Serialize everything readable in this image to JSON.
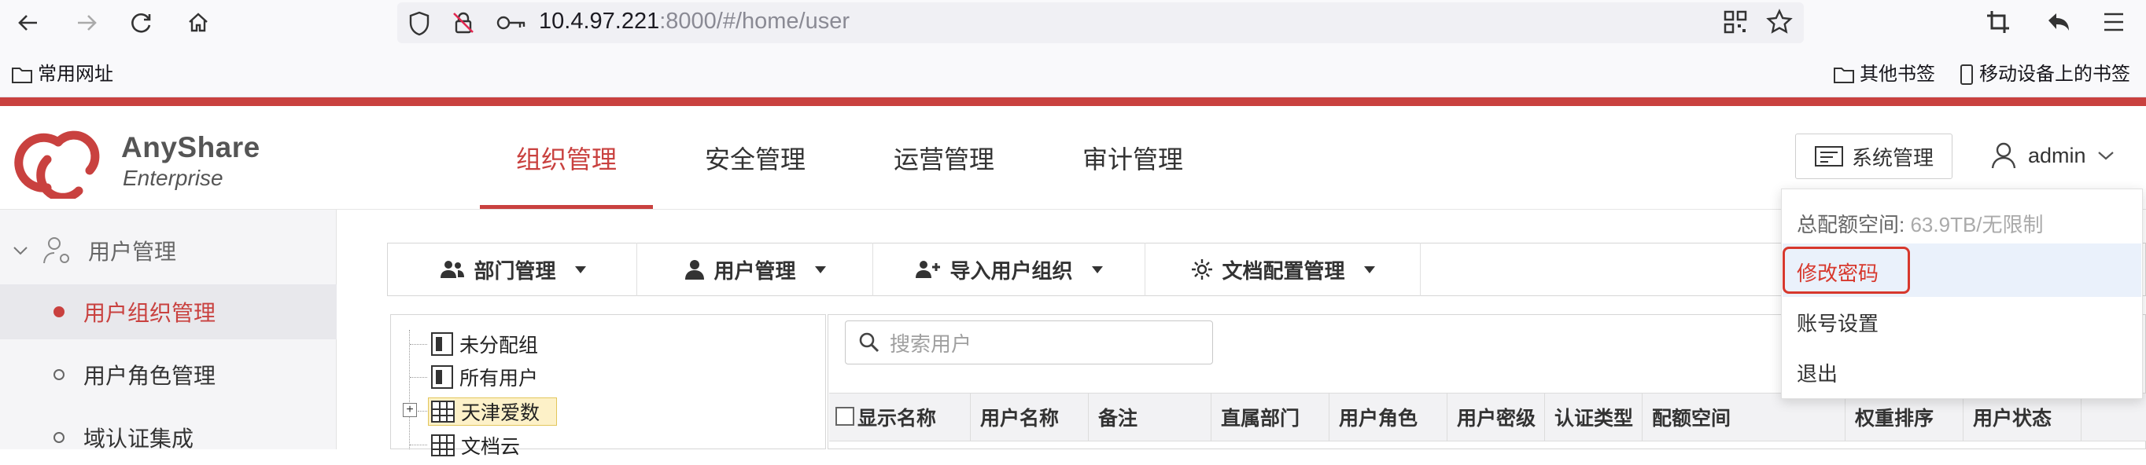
{
  "browser": {
    "url_host": "10.4.97.221",
    "url_rest": ":8000/#/home/user",
    "bookmarks_left": "常用网址",
    "bookmarks_right": [
      "其他书签",
      "移动设备上的书签"
    ]
  },
  "app": {
    "brand": "AnyShare",
    "brand_sub": "Enterprise",
    "tabs": [
      "组织管理",
      "安全管理",
      "运营管理",
      "审计管理"
    ],
    "active_tab": "组织管理",
    "system_button": "系统管理",
    "username": "admin"
  },
  "sidebar": {
    "group": "用户管理",
    "items": [
      "用户组织管理",
      "用户角色管理",
      "域认证集成"
    ],
    "active_item": "用户组织管理"
  },
  "toolbar": {
    "items": [
      "部门管理",
      "用户管理",
      "导入用户组织",
      "文档配置管理"
    ]
  },
  "tree": {
    "nodes": [
      "未分配组",
      "所有用户",
      "天津爱数",
      "文档云"
    ]
  },
  "users": {
    "search_placeholder": "搜索用户",
    "columns": [
      "显示名称",
      "用户名称",
      "备注",
      "直属部门",
      "用户角色",
      "用户密级",
      "认证类型",
      "配额空间",
      "权重排序",
      "用户状态"
    ]
  },
  "dropdown": {
    "quota_label": "总配额空间:",
    "quota_value": "63.9TB/无限制",
    "change_password": "修改密码",
    "account_settings": "账号设置",
    "logout": "退出"
  },
  "colors": {
    "accent": "#c9413f",
    "highlight_box": "#d7382d"
  }
}
